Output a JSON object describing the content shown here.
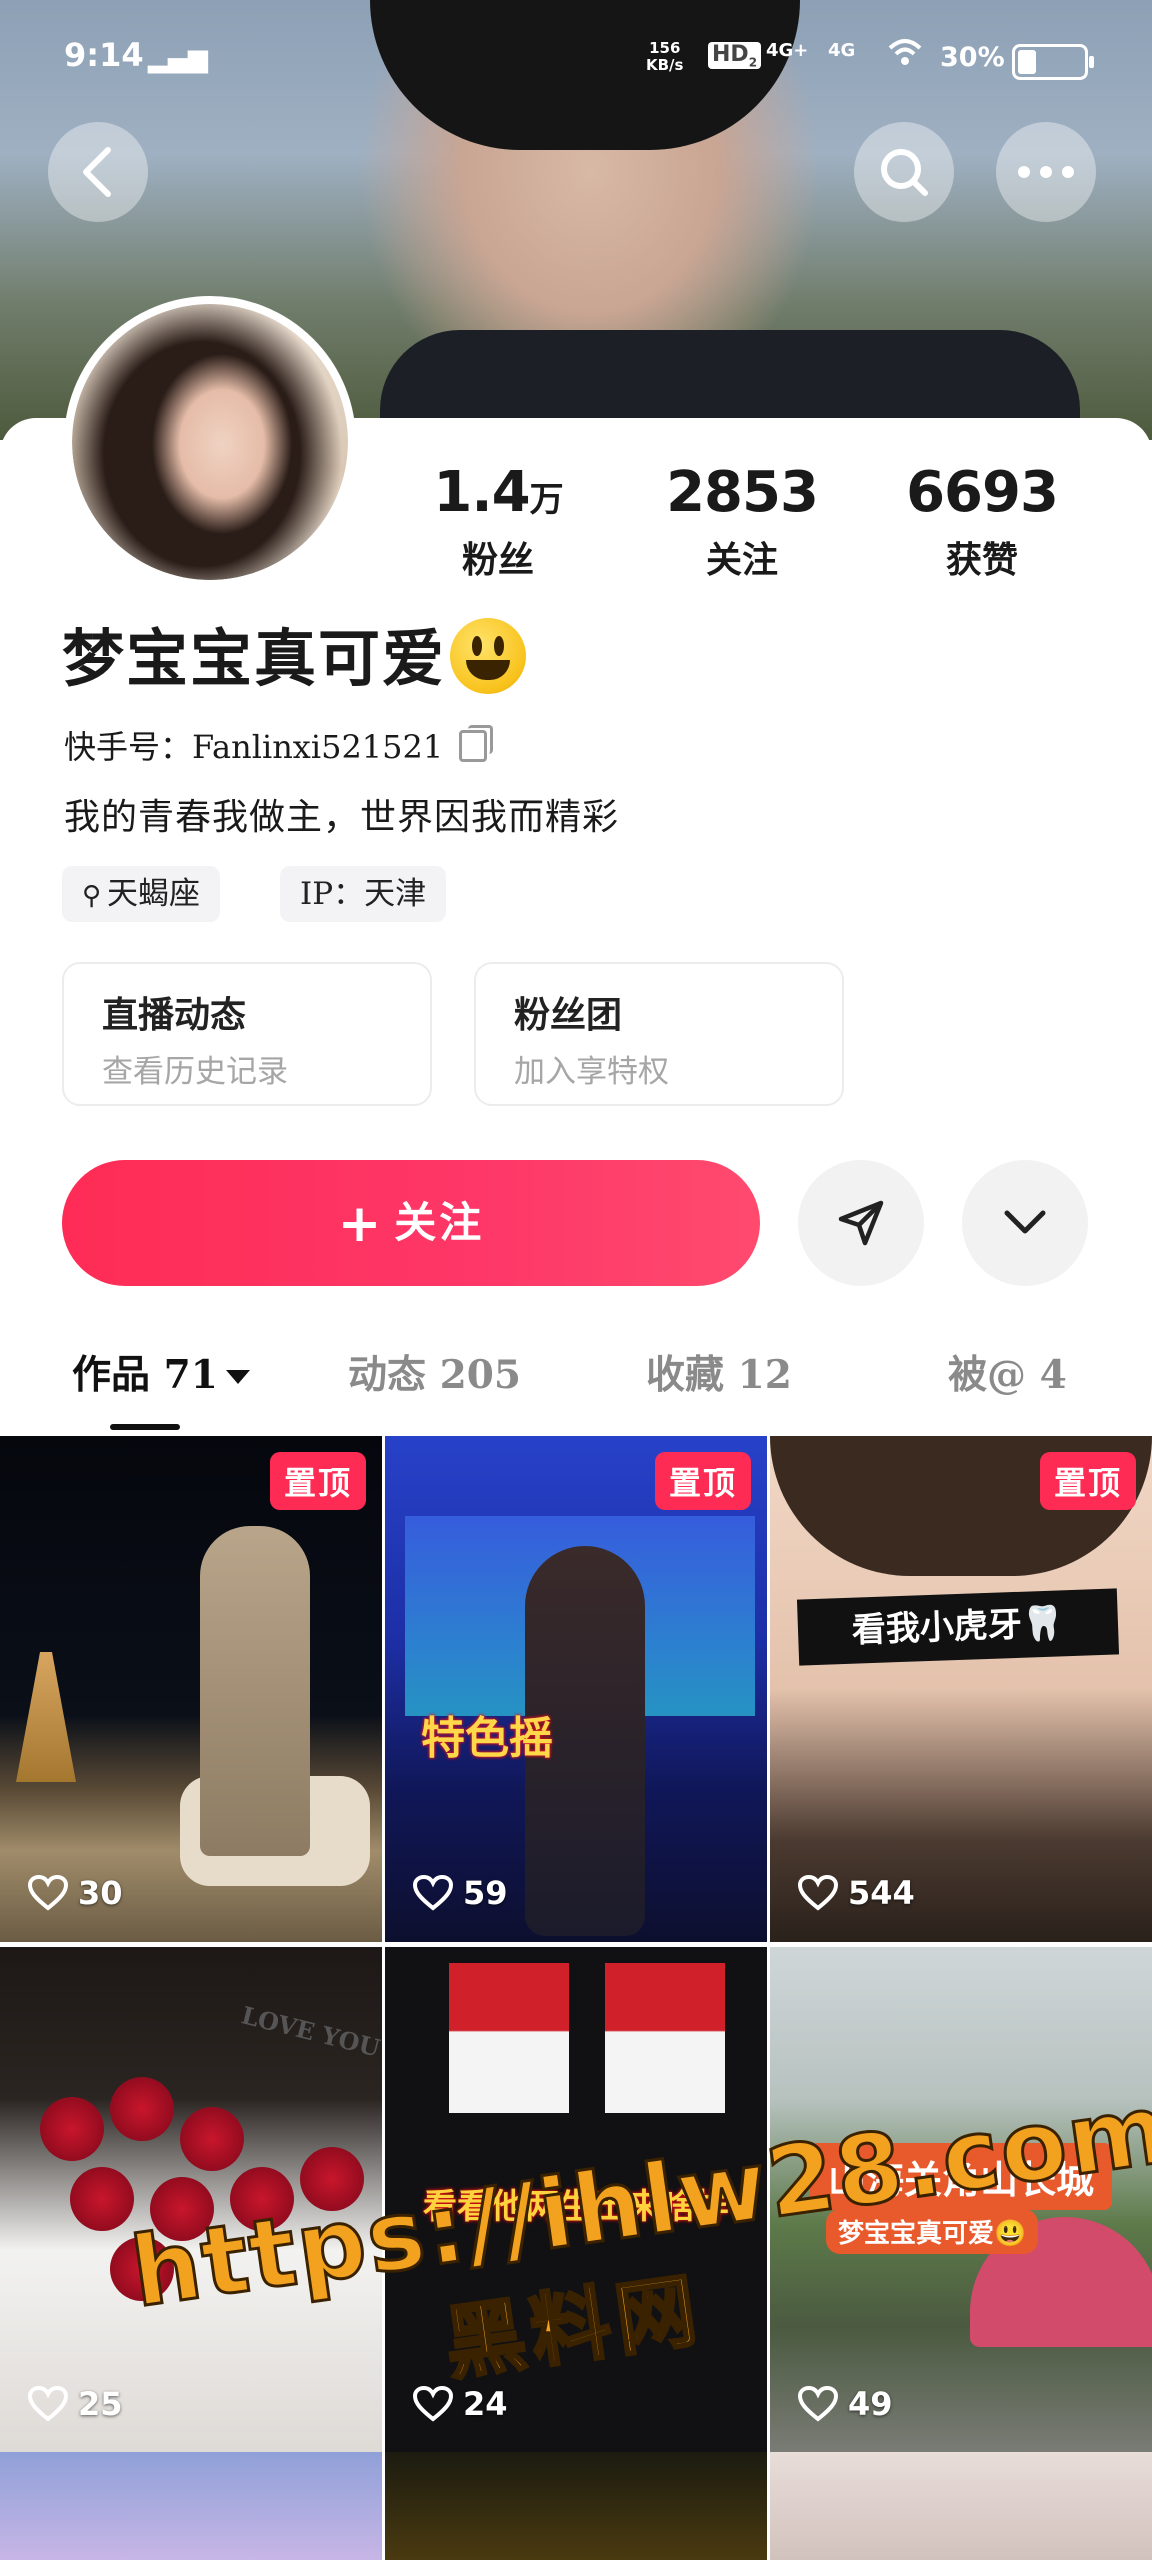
{
  "status_bar": {
    "time": "9:14",
    "net_rate": "156",
    "net_unit": "KB/s",
    "hd": "HD",
    "hd_sub": "2",
    "sig1": "4G+",
    "sig2": "4G",
    "battery": "30%"
  },
  "profile": {
    "stats": [
      {
        "num": "1.4",
        "unit": "万",
        "label": "粉丝"
      },
      {
        "num": "2853",
        "label": "关注"
      },
      {
        "num": "6693",
        "label": "获赞"
      }
    ],
    "name": "梦宝宝真可爱",
    "kuaishou_id": "快手号：Fanlinxi521521",
    "bio": "我的青春我做主，世界因我而精彩",
    "tags": [
      "天蝎座",
      "IP：天津"
    ],
    "entries": [
      {
        "title": "直播动态",
        "subtitle": "查看历史记录"
      },
      {
        "title": "粉丝团",
        "subtitle": "加入享特权"
      }
    ],
    "follow_label": "关注"
  },
  "tabs": [
    {
      "label": "作品 71",
      "active": true
    },
    {
      "label": "动态 205"
    },
    {
      "label": "收藏 12"
    },
    {
      "label": "被@ 4"
    }
  ],
  "posts": [
    {
      "likes": "30",
      "pinned": "置顶"
    },
    {
      "likes": "59",
      "pinned": "置顶",
      "caption": "特色摇"
    },
    {
      "likes": "544",
      "pinned": "置顶",
      "caption": "看我小虎牙🦷"
    },
    {
      "likes": "25",
      "caption": "LOVE YOU"
    },
    {
      "likes": "24",
      "caption": "看看他两生出来啥样"
    },
    {
      "likes": "49",
      "caption": "山海关角山长城",
      "caption2": "梦宝宝真可爱😃"
    }
  ],
  "watermark": {
    "url": "https://ihlw28.com",
    "cn": "黑料网"
  },
  "colors": {
    "accent": "#fe2c55",
    "pin": "#fe2c55"
  }
}
